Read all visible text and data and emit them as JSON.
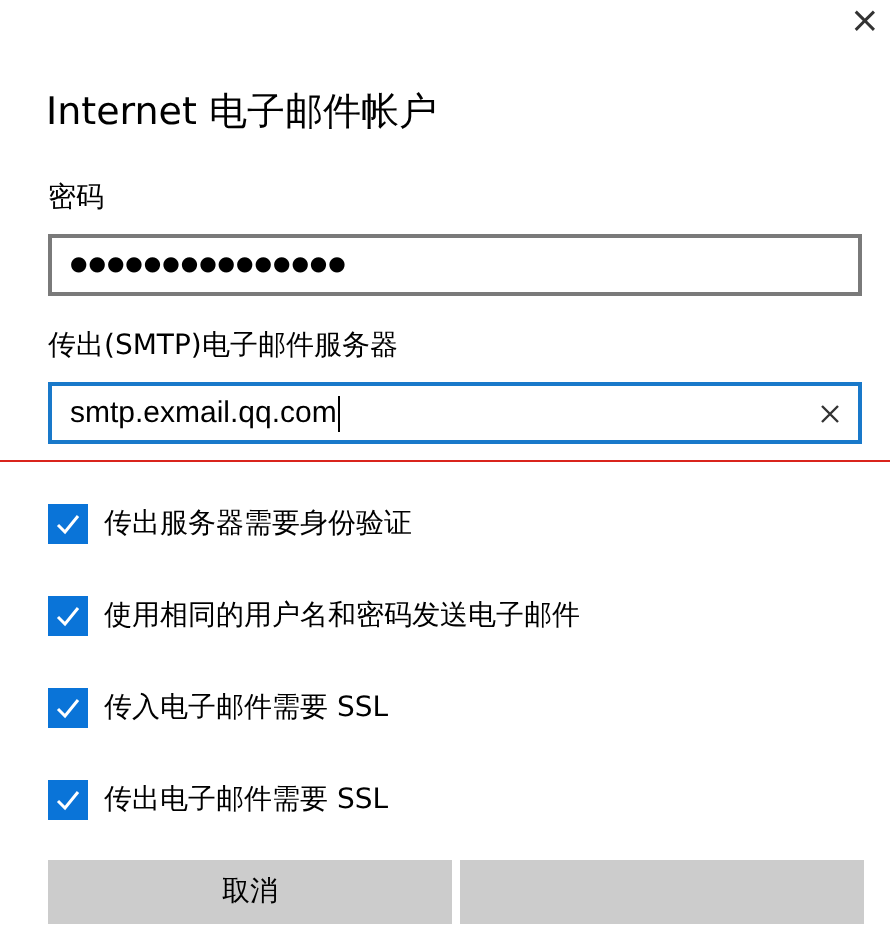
{
  "close_button": {
    "glyph": "×"
  },
  "title": "Internet 电子邮件帐户",
  "fields": [
    {
      "kind": "password",
      "label": "密码",
      "value": "●●●●●●●●●●●●●●●",
      "focused": false
    },
    {
      "kind": "text",
      "label": "传出(SMTP)电子邮件服务器",
      "value": "smtp.exmail.qq.com",
      "focused": true
    }
  ],
  "checkboxes": [
    {
      "label": "传出服务器需要身份验证",
      "checked": true
    },
    {
      "label": "使用相同的用户名和密码发送电子邮件",
      "checked": true
    },
    {
      "label": "传入电子邮件需要 SSL",
      "checked": true
    },
    {
      "label": "传出电子邮件需要 SSL",
      "checked": true
    }
  ],
  "buttons": [
    {
      "label": "取消"
    }
  ]
}
